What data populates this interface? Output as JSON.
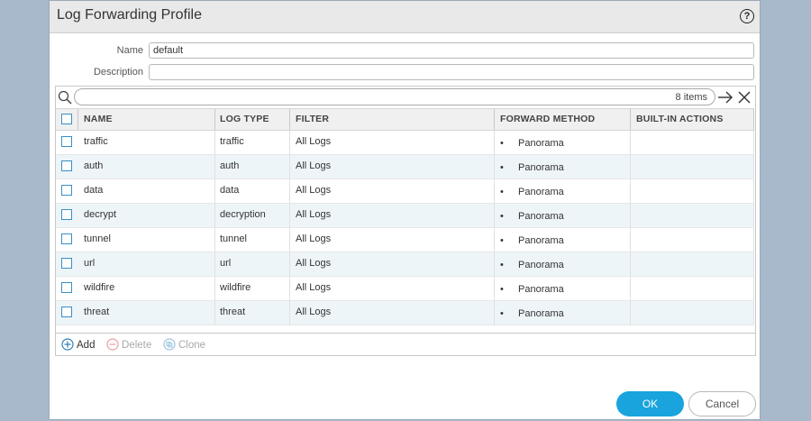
{
  "dialog": {
    "title": "Log Forwarding Profile",
    "help_icon": "help-icon"
  },
  "form": {
    "name_label": "Name",
    "name_value": "default",
    "description_label": "Description",
    "description_value": ""
  },
  "grid": {
    "items_count": "8 items",
    "search_placeholder": "",
    "columns": [
      "NAME",
      "LOG TYPE",
      "FILTER",
      "FORWARD METHOD",
      "BUILT-IN ACTIONS"
    ],
    "rows": [
      {
        "name": "traffic",
        "log_type": "traffic",
        "filter": "All Logs",
        "forward_method": "Panorama",
        "actions": ""
      },
      {
        "name": "auth",
        "log_type": "auth",
        "filter": "All Logs",
        "forward_method": "Panorama",
        "actions": ""
      },
      {
        "name": "data",
        "log_type": "data",
        "filter": "All Logs",
        "forward_method": "Panorama",
        "actions": ""
      },
      {
        "name": "decrypt",
        "log_type": "decryption",
        "filter": "All Logs",
        "forward_method": "Panorama",
        "actions": ""
      },
      {
        "name": "tunnel",
        "log_type": "tunnel",
        "filter": "All Logs",
        "forward_method": "Panorama",
        "actions": ""
      },
      {
        "name": "url",
        "log_type": "url",
        "filter": "All Logs",
        "forward_method": "Panorama",
        "actions": ""
      },
      {
        "name": "wildfire",
        "log_type": "wildfire",
        "filter": "All Logs",
        "forward_method": "Panorama",
        "actions": ""
      },
      {
        "name": "threat",
        "log_type": "threat",
        "filter": "All Logs",
        "forward_method": "Panorama",
        "actions": ""
      }
    ],
    "footer": {
      "add_label": "Add",
      "delete_label": "Delete",
      "clone_label": "Clone"
    }
  },
  "buttons": {
    "ok_label": "OK",
    "cancel_label": "Cancel"
  },
  "colors": {
    "accent": "#1aa4dd",
    "checkbox": "#3a8fc4",
    "row_alt": "#eef5f9",
    "disabled": "#9a9a9a"
  }
}
